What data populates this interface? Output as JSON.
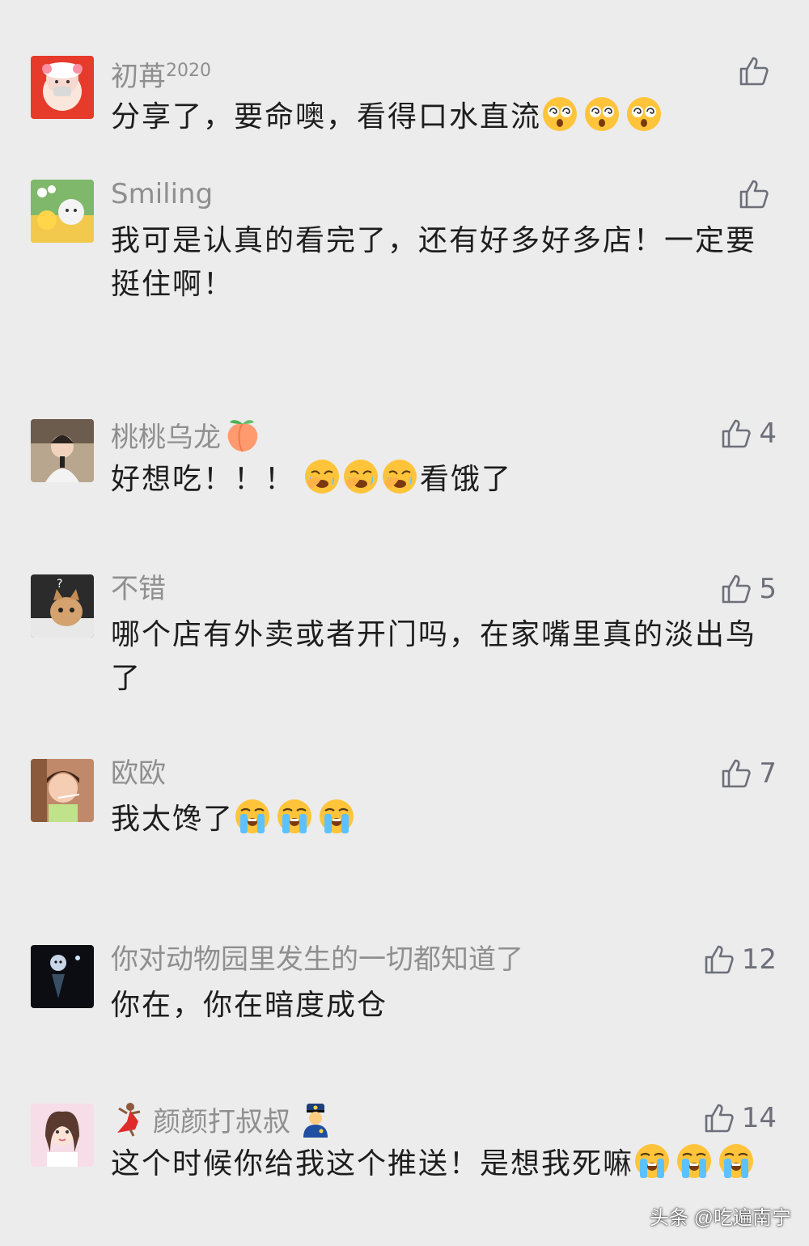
{
  "comments": [
    {
      "username": "初苒",
      "username_suffix": "2020",
      "text": "分享了，要命噢，看得口水直流",
      "emojis": [
        "dizzy-face-emoji",
        "dizzy-face-emoji",
        "dizzy-face-emoji"
      ],
      "likes": ""
    },
    {
      "username": "Smiling",
      "text": "我可是认真的看完了，还有好多好多店！一定要挺住啊！",
      "likes": ""
    },
    {
      "username": "桃桃乌龙",
      "username_emoji": "peach-emoji",
      "text_before": "好想吃！！！",
      "emojis": [
        "face-palm-cry-emoji",
        "face-palm-cry-emoji",
        "face-palm-cry-emoji"
      ],
      "text_after": "看饿了",
      "likes": "4"
    },
    {
      "username": "不错",
      "text": "哪个店有外卖或者开门吗，在家嘴里真的淡出鸟了",
      "likes": "5"
    },
    {
      "username": "欧欧",
      "text": "我太馋了",
      "emojis": [
        "loudly-crying-emoji",
        "loudly-crying-emoji",
        "loudly-crying-emoji"
      ],
      "likes": "7"
    },
    {
      "username": "你对动物园里发生的一切都知道了",
      "text": "你在，你在暗度成仓",
      "likes": "12"
    },
    {
      "username_prefix_emoji": "dancer-emoji",
      "username": "颜颜打叔叔",
      "username_emoji": "police-officer-emoji",
      "text": "这个时候你给我这个推送！是想我死嘛",
      "emojis": [
        "loudly-crying-emoji",
        "loudly-crying-emoji",
        "loudly-crying-emoji"
      ],
      "likes": "14"
    }
  ],
  "watermark": "头条 @吃遍南宁",
  "colors": {
    "background": "#ececec",
    "username": "#8f8f8f",
    "text": "#1d1d1d",
    "like": "#6d6f7a"
  }
}
